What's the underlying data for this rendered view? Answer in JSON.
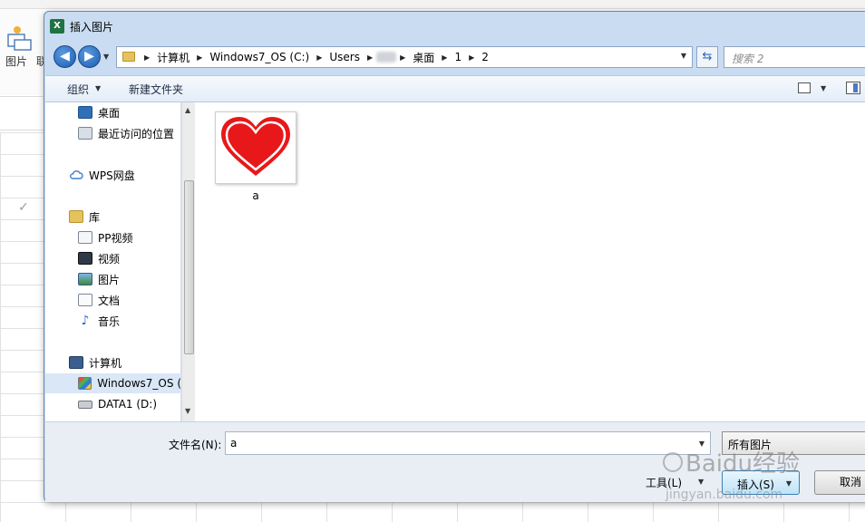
{
  "background": {
    "ribbon_picture_label": "图片",
    "ribbon_next_label": "联"
  },
  "dialog": {
    "title": "插入图片",
    "title_icon": "excel-icon",
    "breadcrumb": [
      "计算机",
      "Windows7_OS (C:)",
      "Users",
      "桌面",
      "1",
      "2"
    ],
    "search_placeholder": "搜索 2",
    "toolbar": {
      "organize": "组织",
      "new_folder": "新建文件夹"
    },
    "nav_items": [
      {
        "label": "桌面",
        "icon": "desktop-icon"
      },
      {
        "label": "最近访问的位置",
        "icon": "recent-places-icon"
      },
      {
        "label": "WPS网盘",
        "icon": "cloud-icon"
      },
      {
        "label": "库",
        "icon": "library-icon"
      },
      {
        "label": "PP视频",
        "icon": "video-file-icon"
      },
      {
        "label": "视频",
        "icon": "film-icon"
      },
      {
        "label": "图片",
        "icon": "pictures-icon"
      },
      {
        "label": "文档",
        "icon": "documents-icon"
      },
      {
        "label": "音乐",
        "icon": "music-icon"
      },
      {
        "label": "计算机",
        "icon": "computer-icon"
      },
      {
        "label": "Windows7_OS (",
        "icon": "system-drive-icon"
      },
      {
        "label": "DATA1 (D:)",
        "icon": "drive-icon"
      }
    ],
    "files": [
      {
        "name": "a",
        "thumbnail": "heart-icon"
      }
    ],
    "filename_label": "文件名(N):",
    "filename_value": "a",
    "filetype_value": "所有图片",
    "tools_label": "工具(L)",
    "insert_label": "插入(S)",
    "cancel_label": "取消"
  },
  "colors": {
    "heart": "#e8181a",
    "dialog_frame": "#c9dcf1",
    "selected_item": "#d9e7f7"
  },
  "watermark": {
    "brand": "Baidu经验",
    "url": "jingyan.baidu.com"
  }
}
